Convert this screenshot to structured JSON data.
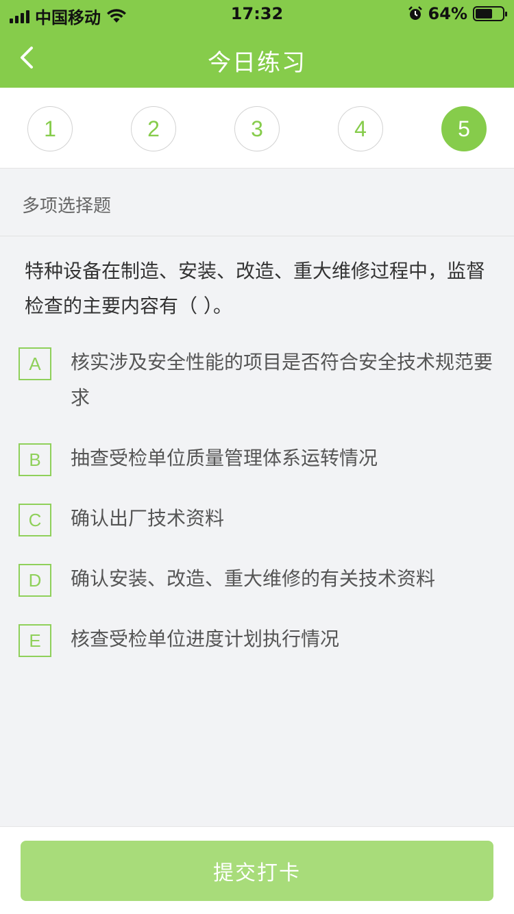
{
  "status_bar": {
    "carrier": "中国移动",
    "time": "17:32",
    "battery": "64%",
    "battery_level": 0.64
  },
  "nav": {
    "title": "今日练习",
    "back_icon": "chevron-left-icon"
  },
  "steps": [
    {
      "label": "1",
      "active": false
    },
    {
      "label": "2",
      "active": false
    },
    {
      "label": "3",
      "active": false
    },
    {
      "label": "4",
      "active": false
    },
    {
      "label": "5",
      "active": true
    }
  ],
  "question_type": "多项选择题",
  "question": "特种设备在制造、安装、改造、重大维修过程中，监督检查的主要内容有（ ）。",
  "options": [
    {
      "letter": "A",
      "text": "核实涉及安全性能的项目是否符合安全技术规范要求"
    },
    {
      "letter": "B",
      "text": "抽查受检单位质量管理体系运转情况"
    },
    {
      "letter": "C",
      "text": "确认出厂技术资料"
    },
    {
      "letter": "D",
      "text": "确认安装、改造、重大维修的有关技术资料"
    },
    {
      "letter": "E",
      "text": "核查受检单位进度计划执行情况"
    }
  ],
  "submit_label": "提交打卡",
  "colors": {
    "brand_green": "#86cc4b",
    "button_disabled": "#a8dc7a"
  }
}
